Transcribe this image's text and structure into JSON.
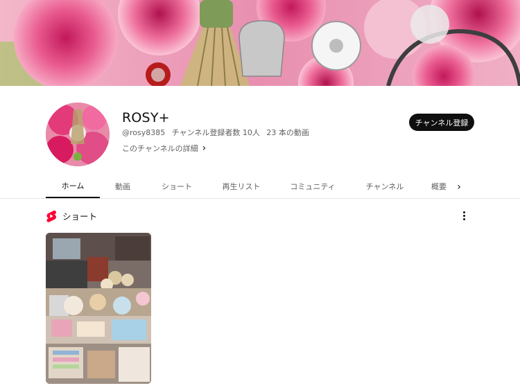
{
  "channel": {
    "name": "ROSY+",
    "handle": "@rosy8385",
    "subscribers": "チャンネル登録者数 10人",
    "videos": "23 本の動画",
    "details_label": "このチャンネルの詳細",
    "details_chevron": "›",
    "subscribe_label": "チャンネル登録"
  },
  "tabs": [
    {
      "label": "ホーム",
      "active": true
    },
    {
      "label": "動画"
    },
    {
      "label": "ショート"
    },
    {
      "label": "再生リスト"
    },
    {
      "label": "コミュニティ"
    },
    {
      "label": "チャンネル"
    },
    {
      "label": "概要"
    }
  ],
  "tabs_next_icon": "›",
  "sections": {
    "shorts_title": "ショート"
  },
  "colors": {
    "subscribe_bg": "#0f0f0f",
    "shorts_red": "#ff0033",
    "banner_pink": "#e8a7bf"
  },
  "icons": {
    "shorts": "youtube-shorts-icon",
    "more": "vertical-ellipsis-icon",
    "chevron": "chevron-right-icon"
  }
}
